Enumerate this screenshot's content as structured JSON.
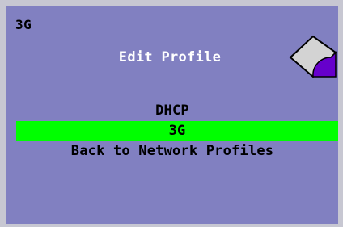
{
  "screen": {
    "corner_label": "3G",
    "title": "Edit Profile",
    "icon": "profile-settings-icon"
  },
  "menu": {
    "items": [
      {
        "label": "DHCP",
        "selected": false
      },
      {
        "label": "3G",
        "selected": true
      },
      {
        "label": "Back to Network Profiles",
        "selected": false
      }
    ]
  },
  "colors": {
    "background": "#8180c1",
    "highlight": "#00ff00",
    "title_text": "#ffffff",
    "icon_fill": "#d3d3d3",
    "icon_accent": "#6600cc"
  }
}
